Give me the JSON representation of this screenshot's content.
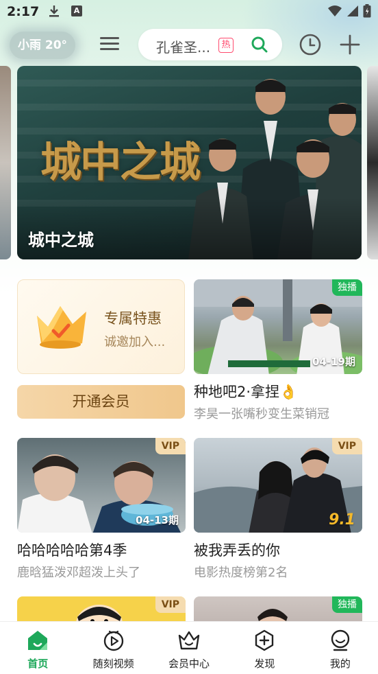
{
  "status_bar": {
    "time": "2:17"
  },
  "header": {
    "weather": "小雨 20°",
    "search_placeholder": "孔雀圣...",
    "hot_badge": "热"
  },
  "banner": {
    "title": "城中之城",
    "logo_text": "城中之城"
  },
  "promo": {
    "title": "专属特惠",
    "subtitle": "诚邀加入...",
    "button": "开通会员"
  },
  "cards": [
    {
      "title": "种地吧2·拿捏👌",
      "subtitle": "李昊一张嘴秒变生菜销冠",
      "badge": "独播",
      "episode": "04-19期"
    },
    {
      "title": "哈哈哈哈哈第4季",
      "subtitle": "鹿晗猛泼邓超泼上头了",
      "badge": "VIP",
      "episode": "04-13期"
    },
    {
      "title": "被我弄丢的你",
      "subtitle": "电影热度榜第2名",
      "badge": "VIP",
      "score": "9.1"
    },
    {
      "badge": "VIP"
    },
    {
      "badge": "独播"
    }
  ],
  "bottom_nav": [
    {
      "label": "首页",
      "active": true
    },
    {
      "label": "随刻视频"
    },
    {
      "label": "会员中心"
    },
    {
      "label": "发现"
    },
    {
      "label": "我的"
    }
  ],
  "colors": {
    "accent": "#1ea85a",
    "badge_green": "#21b75a",
    "vip_gold": "#f5dcb0"
  }
}
